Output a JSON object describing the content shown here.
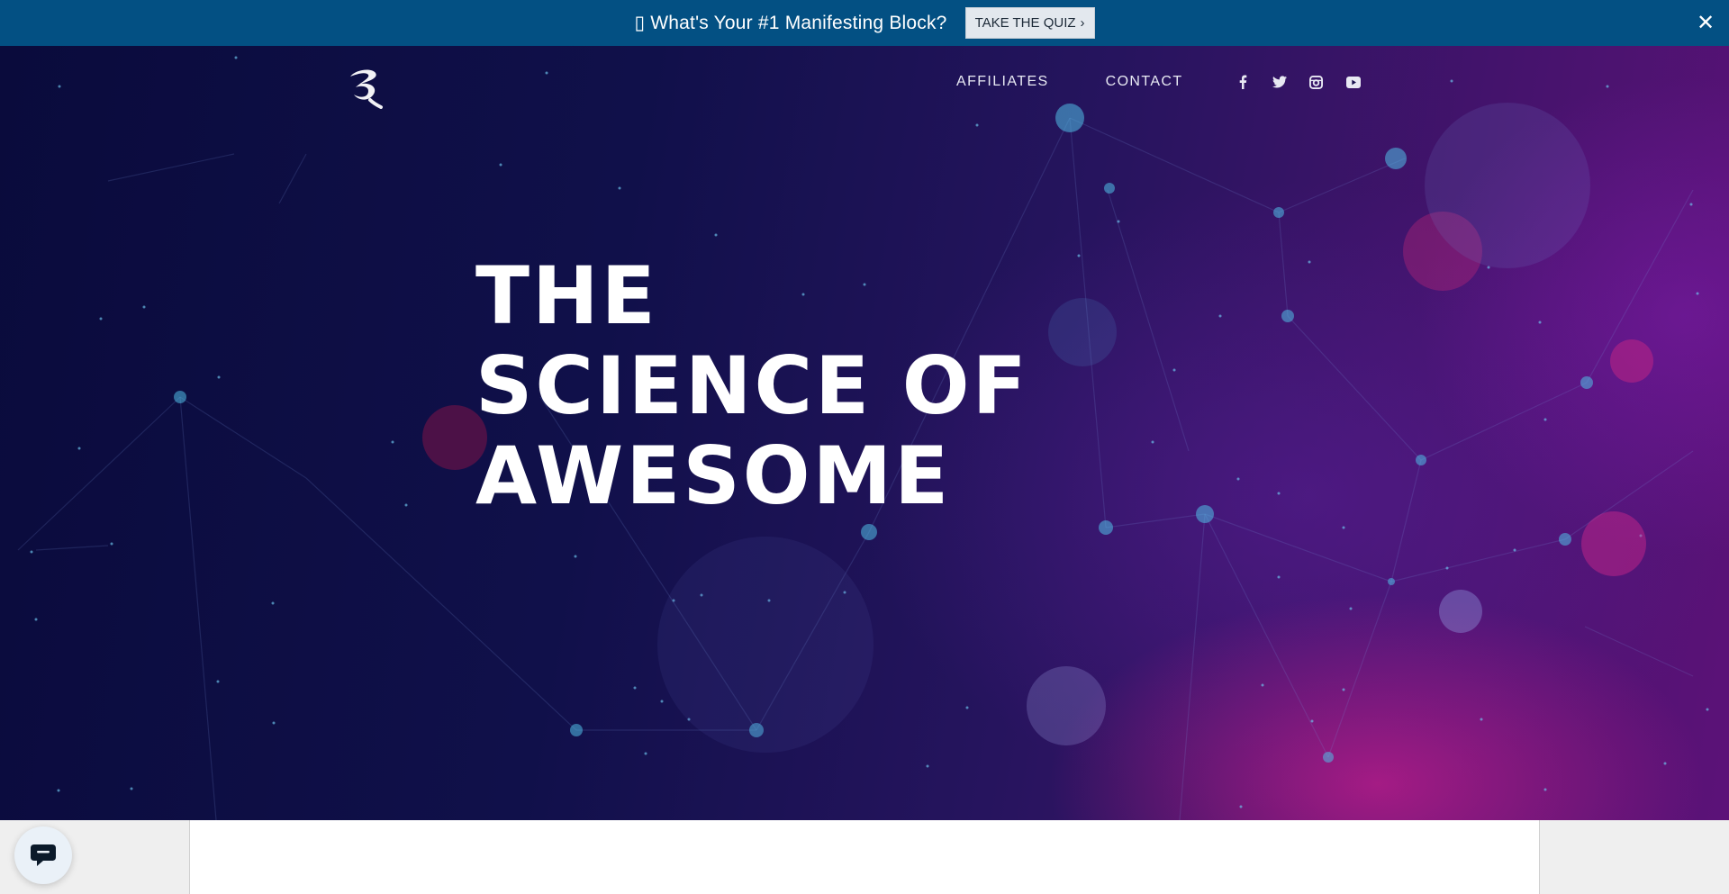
{
  "promo": {
    "text": "▯ What's Your #1 Manifesting Block?",
    "button_label": "TAKE THE QUIZ",
    "button_chevron": "›",
    "close_icon": "✕"
  },
  "header": {
    "logo": "logo-icon",
    "nav": [
      {
        "label": "AFFILIATES"
      },
      {
        "label": "CONTACT"
      }
    ],
    "social": [
      "facebook-icon",
      "twitter-icon",
      "instagram-icon",
      "youtube-icon"
    ]
  },
  "hero": {
    "headline_lines": [
      "THE",
      "SCIENCE OF",
      "AWESOME"
    ]
  },
  "chat": {
    "icon": "chat-bubble-icon"
  },
  "colors": {
    "promo_bar": "#035083",
    "hero_dark": "#0a0b3c",
    "hero_magenta": "#c41e8c",
    "text_white": "#ffffff"
  }
}
